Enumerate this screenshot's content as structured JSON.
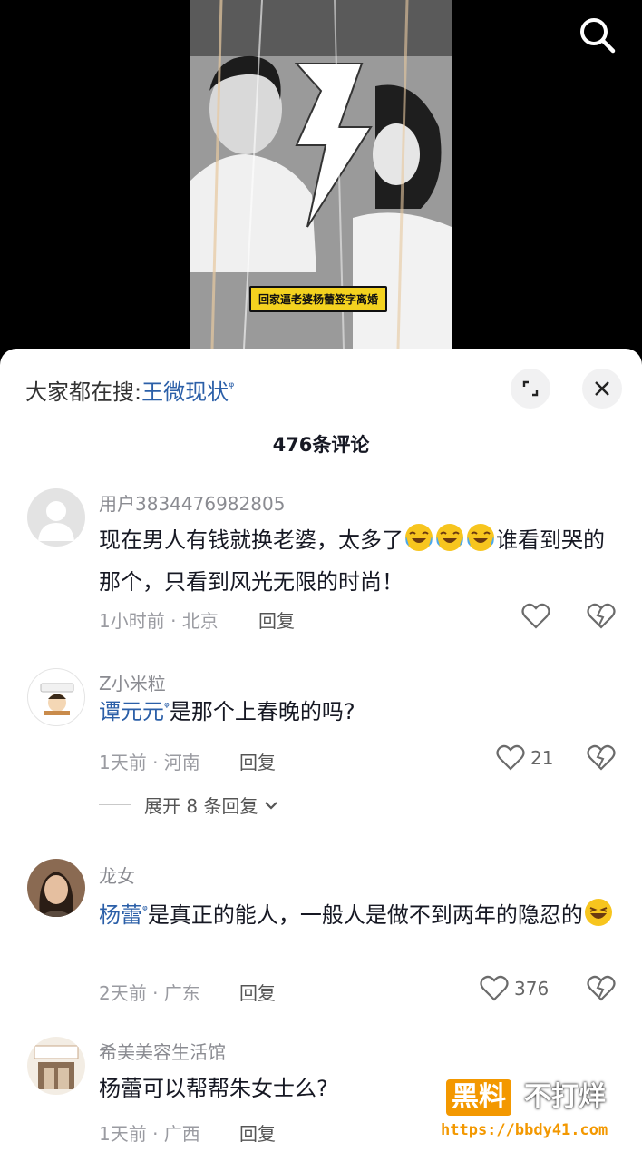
{
  "video": {
    "caption": "回家逼老婆杨蕾签字离婚"
  },
  "header": {
    "hot_search_prefix": "大家都在搜:",
    "hot_search_keyword": "王微现状",
    "search_mark": "ᵠ"
  },
  "comment_count": "476条评论",
  "comments": [
    {
      "name": "用户3834476982805",
      "text_before": "现在男人有钱就换老婆，太多了",
      "emoji_count": 3,
      "text_after": "谁看到哭的那个，只看到风光无限的时尚！",
      "meta": "1小时前 · 北京",
      "reply": "回复",
      "likes": ""
    },
    {
      "name": "Z小米粒",
      "keyword": "谭元元",
      "text_after": "是那个上春晚的吗?",
      "meta": "1天前 · 河南",
      "reply": "回复",
      "likes": "21",
      "expand": "展开 8 条回复"
    },
    {
      "name": "龙女",
      "keyword": "杨蕾",
      "text_after": "是真正的能人，一般人是做不到两年的隐忍的",
      "meta": "2天前 · 广东",
      "reply": "回复",
      "likes": "376"
    },
    {
      "name": "希美美容生活馆",
      "text_after": "杨蕾可以帮帮朱女士么?",
      "meta": "1天前 · 广西",
      "reply": "回复",
      "likes": ""
    }
  ],
  "watermark": {
    "badge": "黑料",
    "side": "不打烊",
    "url": "https://bbdy41.com"
  },
  "colors": {
    "keyword_blue": "#2b5fa8",
    "caption_yellow": "#f4d21f",
    "watermark_orange": "#f39800"
  }
}
